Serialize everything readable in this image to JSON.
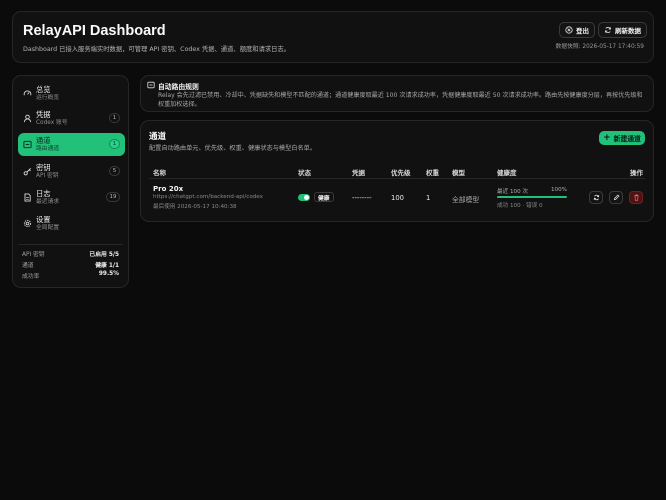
{
  "header": {
    "title": "RelayAPI Dashboard",
    "subtitle": "Dashboard 已接入服务端实时数据，可管理 API 密钥、Codex 凭据、通道、额度和请求日志。",
    "logout_label": "登出",
    "refresh_label": "刷新数据",
    "update_time": "数据快照: 2026-05-17 17:40:59"
  },
  "sidebar": {
    "items": [
      {
        "label": "总览",
        "sub": "运行概览",
        "badge": "",
        "icon": "gauge-icon"
      },
      {
        "label": "凭据",
        "sub": "Codex 账号",
        "badge": "1",
        "icon": "user-icon"
      },
      {
        "label": "通道",
        "sub": "路由通道",
        "badge": "1",
        "icon": "route-icon",
        "active": true
      },
      {
        "label": "密钥",
        "sub": "API 密钥",
        "badge": "5",
        "icon": "key-icon"
      },
      {
        "label": "日志",
        "sub": "最近请求",
        "badge": "19",
        "icon": "file-icon"
      },
      {
        "label": "设置",
        "sub": "全局配置",
        "badge": "",
        "icon": "gear-icon"
      }
    ],
    "stats": [
      {
        "label": "API 密钥",
        "value": "已启用 5/5"
      },
      {
        "label": "通道",
        "value": "健康 1/1"
      },
      {
        "label": "成功率",
        "value": "99.5%"
      }
    ]
  },
  "rules": {
    "title": "自动路由规则",
    "description": "Relay 会先过滤已禁用、冷却中、凭据缺失和模型不匹配的通道；通道健康度取最近 100 次请求成功率，凭据健康度取最近 50 次请求成功率。路由先按健康度分层，再按优先级和权重加权选择。"
  },
  "channels": {
    "title": "通道",
    "description": "配置自动路由单元、优先级、权重、健康状态与模型白名单。",
    "new_label": "新建通道",
    "columns": {
      "name": "名称",
      "status": "状态",
      "credential": "凭据",
      "priority": "优先级",
      "weight": "权重",
      "model": "模型",
      "health": "健康度",
      "actions": "操作"
    },
    "rows": [
      {
        "name": "Pro 20x",
        "url": "https://chatgpt.com/backend-api/codex",
        "last_used": "最后使用 2026-05-17 10:40:38",
        "enabled": true,
        "status": "健康",
        "credential": "--------",
        "priority": "100",
        "weight": "1",
        "model": "全部模型",
        "health_window": "最近 100 次",
        "health_percent": "100%",
        "health_fraction": 1.0,
        "health_detail": "成功 100 · 错误 0"
      }
    ]
  },
  "colors": {
    "accent": "#22c17a",
    "danger": "#4a1414",
    "background": "#0b0b0b"
  }
}
